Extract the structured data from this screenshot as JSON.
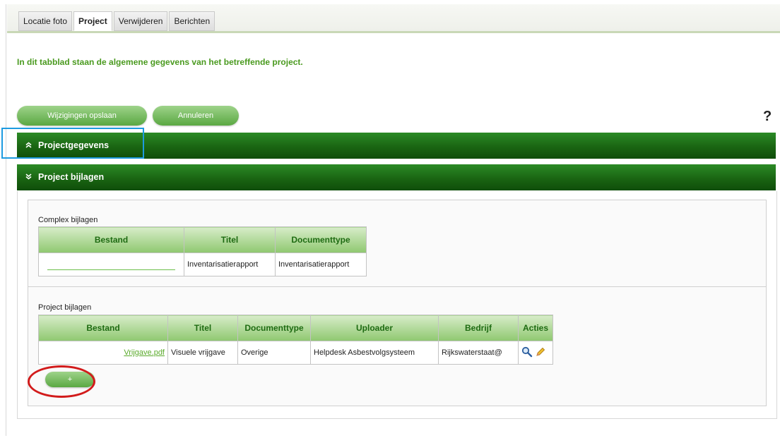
{
  "tabs": [
    "Locatie foto",
    "Project",
    "Verwijderen",
    "Berichten"
  ],
  "active_tab": "Project",
  "intro_text": "In dit tabblad staan de algemene gegevens van het betreffende project.",
  "buttons": {
    "save": "Wijzigingen opslaan",
    "cancel": "Annuleren",
    "help": "?",
    "add": "+"
  },
  "sections": {
    "projectgegevens": "Projectgegevens",
    "project_bijlagen": "Project bijlagen"
  },
  "complex": {
    "label": "Complex bijlagen",
    "headers": [
      "Bestand",
      "Titel",
      "Documenttype"
    ],
    "row": {
      "bestand": "",
      "titel": "Inventarisatierapport",
      "documenttype": "Inventarisatierapport"
    }
  },
  "project": {
    "label": "Project bijlagen",
    "headers": [
      "Bestand",
      "Titel",
      "Documenttype",
      "Uploader",
      "Bedrijf",
      "Acties"
    ],
    "row": {
      "bestand": "Vrijgave.pdf",
      "titel": "Visuele vrijgave",
      "documenttype": "Overige",
      "uploader": "Helpdesk Asbestvolgsysteem",
      "bedrijf": "Rijkswaterstaat@"
    }
  },
  "icons": {
    "view": "magnifier-icon",
    "edit": "pencil-icon",
    "collapse": "chevron-up-icon",
    "expand": "chevron-down-icon"
  },
  "colors": {
    "green_dark": "#1a6512",
    "green_light": "#8fc870",
    "intro_text": "#4a9a1f",
    "highlight_blue": "#1d9be0",
    "highlight_red": "#d21b1b"
  }
}
